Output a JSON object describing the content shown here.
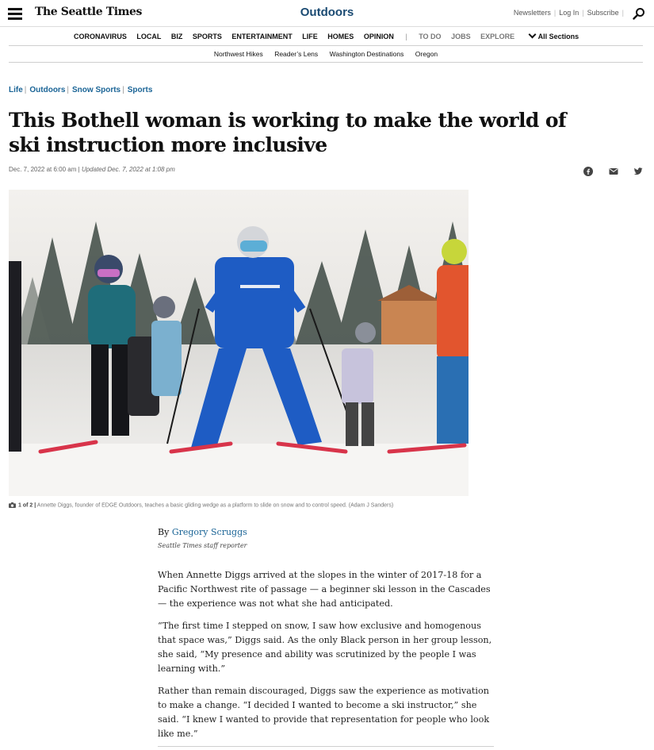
{
  "header": {
    "logo": "The Seattle Times",
    "section": "Outdoors",
    "links": [
      "Newsletters",
      "Log In",
      "Subscribe"
    ]
  },
  "main_nav": {
    "items": [
      "CORONAVIRUS",
      "LOCAL",
      "BIZ",
      "SPORTS",
      "ENTERTAINMENT",
      "LIFE",
      "HOMES",
      "OPINION"
    ],
    "secondary": [
      "TO DO",
      "JOBS",
      "EXPLORE"
    ],
    "separator": "|",
    "all_sections": "All Sections"
  },
  "sub_nav": [
    "Northwest Hikes",
    "Reader’s Lens",
    "Washington Destinations",
    "Oregon"
  ],
  "breadcrumbs": [
    "Life",
    "Outdoors",
    "Snow Sports",
    "Sports"
  ],
  "article": {
    "headline": "This Bothell woman is working to make the world of ski instruction more inclusive",
    "published": "Dec. 7, 2022 at 6:00 am",
    "date_sep": "|",
    "updated": "Updated Dec. 7, 2022 at 1:08 pm",
    "photo_count": "1 of 2",
    "caption_sep": "|",
    "caption": "Annette Diggs, founder of EDGE Outdoors, teaches a basic gliding wedge as a platform to slide on snow and to control speed. (Adam J Sanders)",
    "byline_prefix": "By",
    "author": "Gregory Scruggs",
    "author_role": "Seattle Times staff reporter",
    "paragraphs": [
      "When Annette Diggs arrived at the slopes in the winter of 2017-18 for a Pacific Northwest rite of passage — a beginner ski lesson in the Cascades — the experience was not what she had anticipated.",
      "“The first time I stepped on snow, I saw how exclusive and homogenous that space was,” Diggs said. As the only Black person in her group lesson, she said, “My presence and ability was scrutinized by the people I was learning with.”",
      "Rather than remain discouraged, Diggs saw the experience as motivation to make a change. “I decided I wanted to become a ski instructor,” she said. “I knew I wanted to provide that representation for people who look like me.”"
    ]
  },
  "icons": {
    "menu": "hamburger-icon",
    "search": "search-icon",
    "share": [
      "facebook-icon",
      "email-icon",
      "twitter-icon"
    ],
    "chevron": "chevron-down-icon",
    "camera": "camera-icon"
  },
  "colors": {
    "section": "#1a4a72",
    "link": "#1a6496"
  }
}
